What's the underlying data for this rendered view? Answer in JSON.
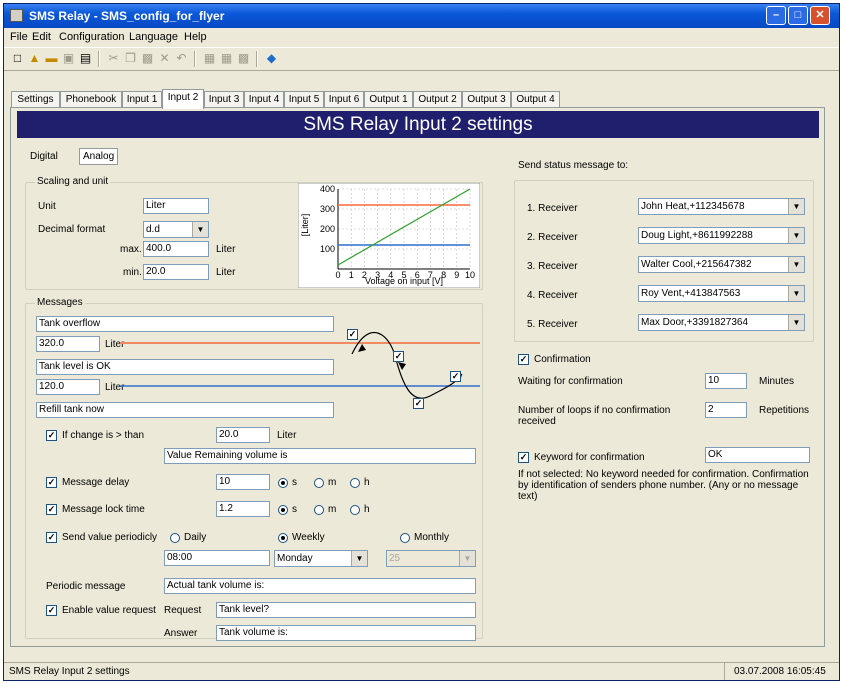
{
  "window": {
    "title": "SMS Relay - SMS_config_for_flyer"
  },
  "menu": [
    {
      "label": "File"
    },
    {
      "label": "Edit"
    },
    {
      "label": "Configuration"
    },
    {
      "label": "Language"
    },
    {
      "label": "Help"
    }
  ],
  "toolbar": [
    "new-icon",
    "open-icon",
    "open-folder-icon",
    "save-icon",
    "print-icon",
    "cut-icon",
    "copy-icon",
    "paste-icon",
    "delete-icon",
    "undo-icon",
    "grid1-icon",
    "grid2-icon",
    "table-icon",
    "help-book-icon"
  ],
  "tabs": [
    "Settings",
    "Phonebook",
    "Input 1",
    "Input 2",
    "Input 3",
    "Input 4",
    "Input 5",
    "Input 6",
    "Output 1",
    "Output 2",
    "Output 3",
    "Output 4"
  ],
  "active_tab": "Input 2",
  "heading": "SMS Relay Input 2 settings",
  "subtabs": {
    "digital": "Digital",
    "analog": "Analog"
  },
  "scaling": {
    "title": "Scaling and unit",
    "unit_label": "Unit",
    "unit_value": "Liter",
    "decimal_label": "Decimal format",
    "decimal_value": "d.d",
    "max_label": "max.",
    "max_value": "400.0",
    "max_unit": "Liter",
    "min_label": "min.",
    "min_value": "20.0",
    "min_unit": "Liter"
  },
  "chart_data": {
    "type": "line",
    "xlabel": "Voltage on input [V]",
    "ylabel": "[Liter]",
    "xlim": [
      0,
      10
    ],
    "ylim": [
      0,
      400
    ],
    "xticks": [
      "0",
      "1",
      "2",
      "3",
      "4",
      "5",
      "6",
      "7",
      "8",
      "9",
      "10"
    ],
    "yticks": [
      "100",
      "200",
      "300",
      "400"
    ],
    "series": [
      {
        "x": [
          0,
          10
        ],
        "y": [
          20,
          400
        ],
        "color": "#2ca02c"
      }
    ],
    "thresholds": [
      {
        "y": 320,
        "color": "#ff6a3a"
      },
      {
        "y": 120,
        "color": "#2e6fd0"
      }
    ]
  },
  "messages": {
    "title": "Messages",
    "msg1": "Tank overflow",
    "lvl1_value": "320.0",
    "lvl1_unit": "Liter",
    "msg2": "Tank level is OK",
    "lvl2_value": "120.0",
    "lvl2_unit": "Liter",
    "msg3": "Refill tank now",
    "change_label": "If change is > than",
    "change_value": "20.0",
    "change_unit": "Liter",
    "change_text": "Value Remaining volume is",
    "delay_label": "Message delay",
    "delay_value": "10",
    "lock_label": "Message lock time",
    "lock_value": "1.2",
    "time_units": [
      "s",
      "m",
      "h"
    ],
    "periodic_label": "Send value periodicly",
    "periodic_options": [
      "Daily",
      "Weekly",
      "Monthly"
    ],
    "periodic_time": "08:00",
    "periodic_day": "Monday",
    "periodic_date": "25",
    "periodic_msg_label": "Periodic message",
    "periodic_msg_value": "Actual tank volume is:",
    "request_label": "Enable value request",
    "request_word": "Request",
    "request_value": "Tank level?",
    "answer_word": "Answer",
    "answer_value": "Tank volume is:"
  },
  "receivers": {
    "title": "Send status message to:",
    "items": [
      {
        "label": "1. Receiver",
        "value": "John Heat,+112345678"
      },
      {
        "label": "2. Receiver",
        "value": "Doug Light,+8611992288"
      },
      {
        "label": "3. Receiver",
        "value": "Walter Cool,+215647382"
      },
      {
        "label": "4. Receiver",
        "value": "Roy Vent,+413847563"
      },
      {
        "label": "5. Receiver",
        "value": "Max Door,+3391827364"
      }
    ]
  },
  "confirmation": {
    "label": "Confirmation",
    "waiting_label": "Waiting for confirmation",
    "waiting_value": "10",
    "waiting_unit": "Minutes",
    "loops_label": "Number of loops if no confirmation received",
    "loops_value": "2",
    "loops_unit": "Repetitions",
    "keyword_label": "Keyword for confirmation",
    "keyword_value": "OK",
    "note": "If not selected: No keyword needed for confirmation.  Confirmation by identification of senders phone number. (Any or no message text)"
  },
  "status": {
    "left": "SMS Relay Input 2 settings",
    "right": "03.07.2008 16:05:45"
  }
}
